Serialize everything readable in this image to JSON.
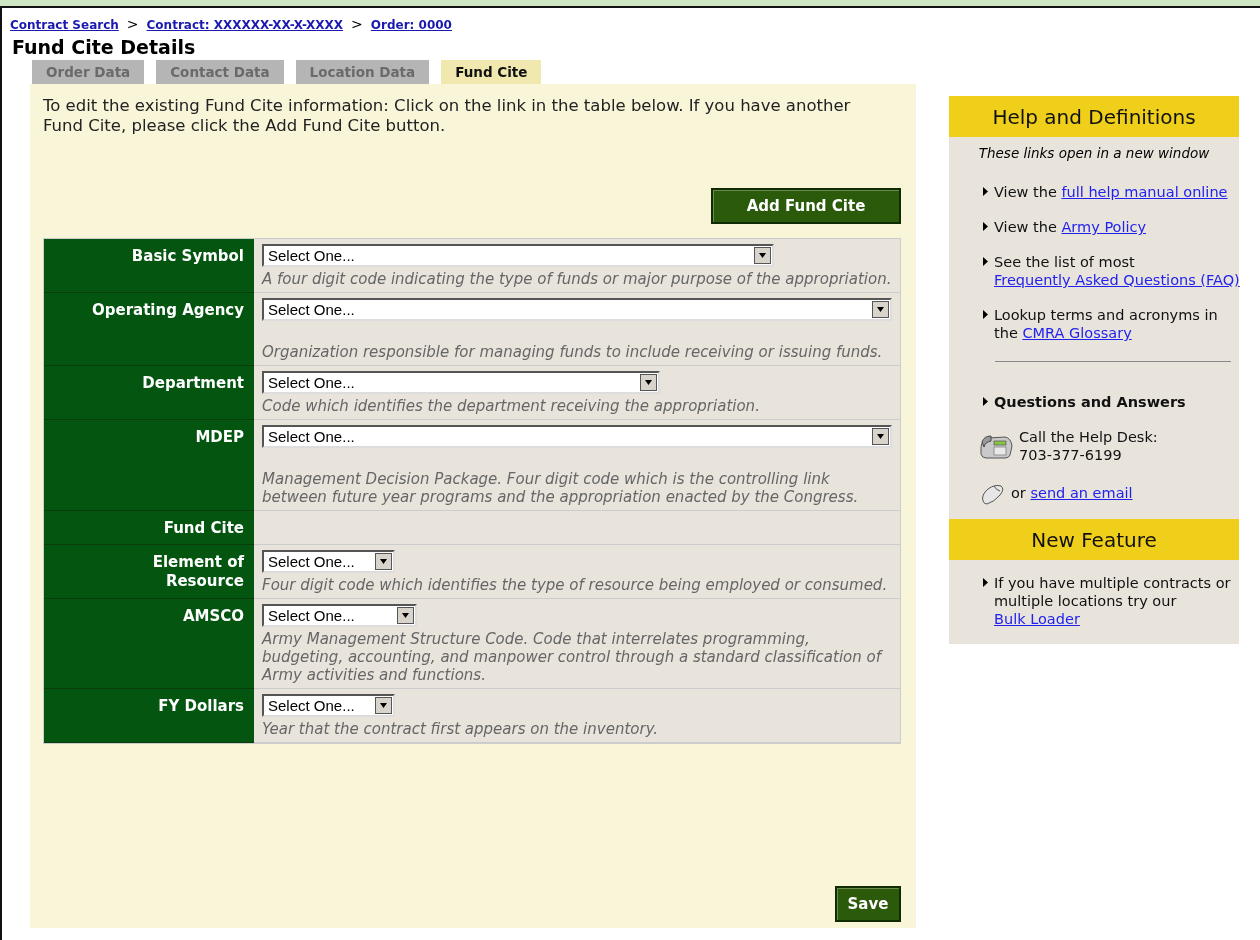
{
  "breadcrumbs": [
    {
      "label": "Contract Search"
    },
    {
      "label": "Contract: XXXXXX-XX-X-XXXX"
    },
    {
      "label": "Order: 0000"
    }
  ],
  "breadcrumb_separators": [
    ">",
    ">"
  ],
  "page_title": "Fund Cite Details",
  "tabs": [
    {
      "label": "Order Data",
      "selected": false
    },
    {
      "label": "Contact Data",
      "selected": false
    },
    {
      "label": "Location Data",
      "selected": false
    },
    {
      "label": "Fund Cite",
      "selected": true
    }
  ],
  "intro": "To edit the existing Fund Cite information: Click on the link in the table below. If you have another Fund Cite, please click the Add Fund Cite button.",
  "add_button": "Add Fund Cite",
  "fields": [
    {
      "label": "Basic Symbol",
      "kind": "select-large",
      "value": "Select One...",
      "description": "A four digit code indicating the type of funds or major purpose of the appropriation."
    },
    {
      "label": "Operating Agency",
      "kind": "select-full",
      "value": "Select One...",
      "description": "Organization responsible for managing funds to include receiving or issuing funds."
    },
    {
      "label": "Department",
      "kind": "select-medium",
      "value": "Select One...",
      "description": "Code which identifies the department receiving the appropriation."
    },
    {
      "label": "MDEP",
      "kind": "select-full",
      "value": "Select One...",
      "description": "Management Decision Package. Four digit code which is the controlling link between future year programs and the appropriation enacted by the Congress."
    },
    {
      "label": "Fund Cite",
      "kind": "label-only"
    },
    {
      "label": "Element of Resource",
      "kind": "select-small",
      "value": "Select One...",
      "description": "Four digit code which identifies the type of resource being employed or consumed."
    },
    {
      "label": "AMSCO",
      "kind": "select-compact",
      "value": "Select One...",
      "description": "Army Management Structure Code. Code that interrelates programming, budgeting, accounting, and manpower control through a standard classification of Army activities and functions."
    },
    {
      "label": "FY Dollars",
      "kind": "select-small",
      "value": "Select One...",
      "description": "Year that the contract first appears on the inventory."
    }
  ],
  "save_button": "Save",
  "help": {
    "title": "Help and Definitions",
    "note": "These links open in a new window",
    "links": [
      {
        "before": "View the ",
        "link": "full help manual online"
      },
      {
        "before": "View the ",
        "link": "Army Policy"
      },
      {
        "before": "See the list of most ",
        "link": "Frequently Asked Questions (FAQ)"
      },
      {
        "before": "Lookup terms and acronyms in the ",
        "link": "CMRA Glossary"
      }
    ],
    "qa_heading": "Questions and Answers",
    "phone_text": "Call the Help Desk: 703-377-6199",
    "email_before": "or ",
    "email_link": "send an email"
  },
  "new_feature": {
    "title": "New Feature",
    "before": "If you have multiple contracts or multiple locations try our ",
    "link": "Bulk Loader"
  }
}
